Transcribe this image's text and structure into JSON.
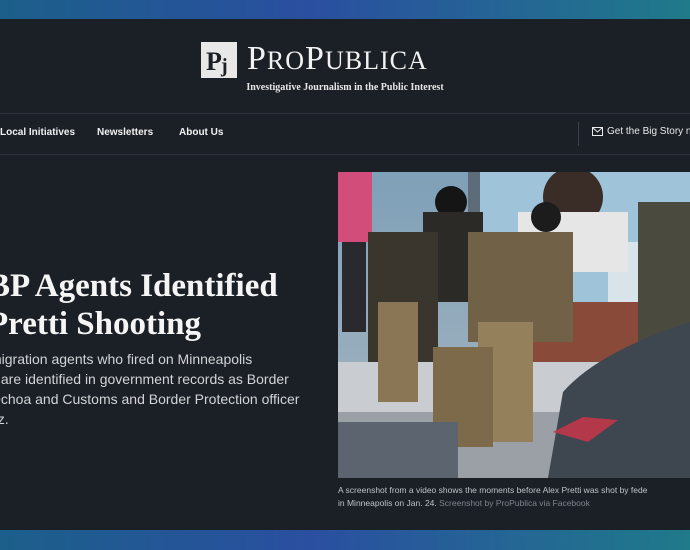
{
  "brand": {
    "logo_mark": "Pj",
    "name_cap1": "P",
    "name_small1": "RO",
    "name_cap2": "P",
    "name_small2": "UBLICA",
    "tagline": "Investigative Journalism in the Public Interest"
  },
  "nav": {
    "items": [
      "Local Initiatives",
      "Newsletters",
      "About Us"
    ],
    "cta_icon": "mail-icon",
    "cta_label": "Get the Big Story ne"
  },
  "story": {
    "headline_line1": "BP Agents Identified",
    "headline_line2": "Pretti Shooting",
    "dek_line1": "migration agents who fired on Minneapolis",
    "dek_line2": "ti are identified in government records as Border",
    "dek_line3": "Ochoa and Customs and Border Protection officer",
    "dek_line4": "ez.",
    "caption_line1": "A screenshot from a video shows the moments before Alex Pretti was shot by fede",
    "caption_line2": "in Minneapolis on Jan. 24.",
    "caption_credit": "Screenshot by ProPublica via Facebook"
  },
  "colors": {
    "background": "#1b2026",
    "outer_gradient_start": "#1c5f8a",
    "outer_gradient_end": "#1f7a8a",
    "text": "#f5f5f5"
  }
}
